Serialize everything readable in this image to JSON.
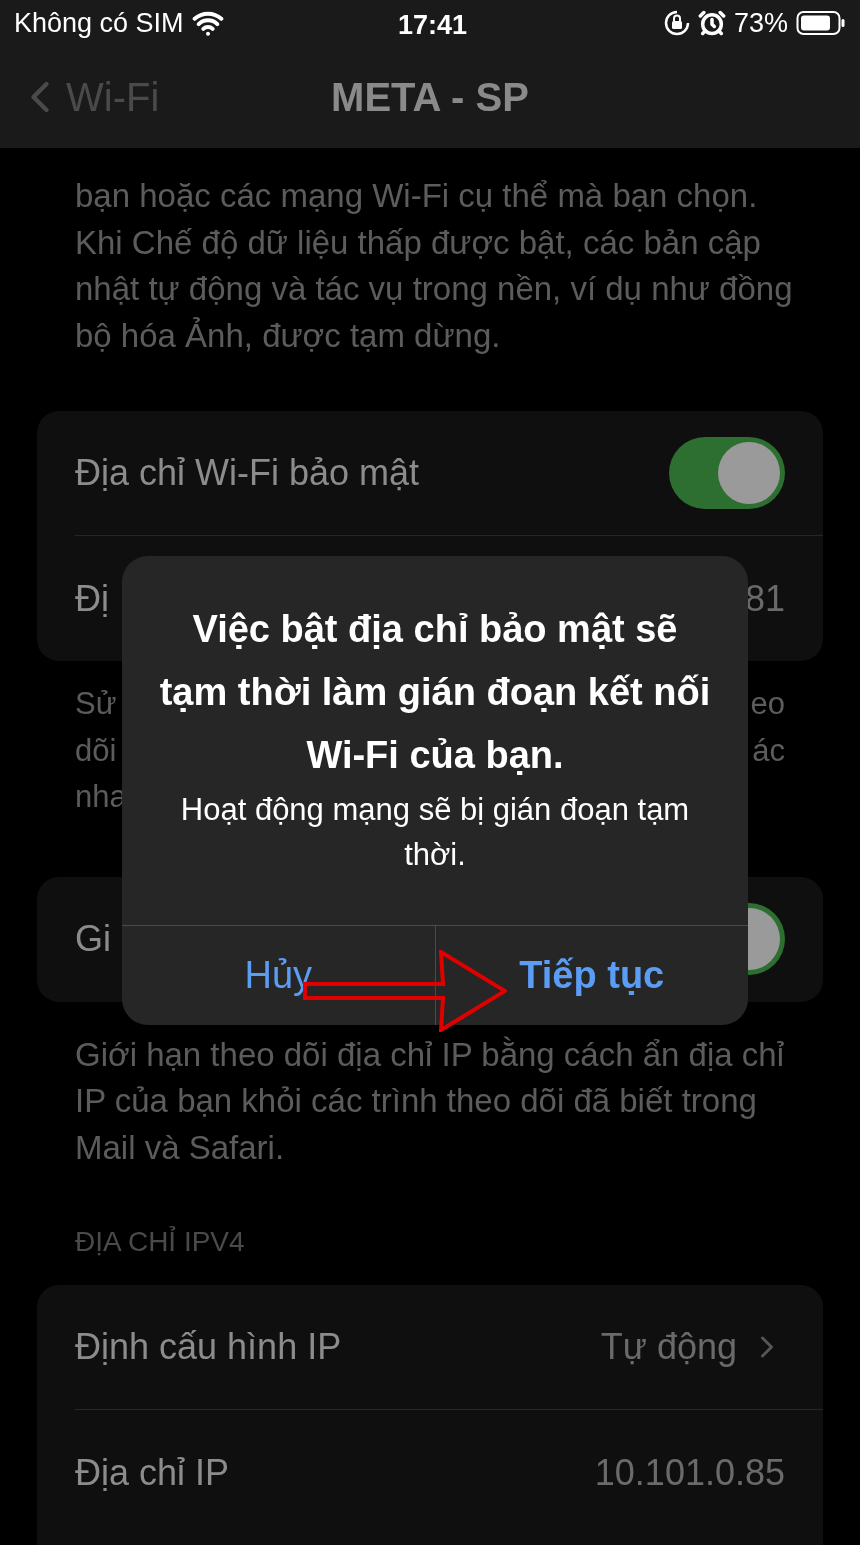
{
  "status_bar": {
    "carrier": "Không có SIM",
    "time": "17:41",
    "battery": "73%"
  },
  "nav": {
    "back": "Wi-Fi",
    "title": "META - SP"
  },
  "low_data_note": "bạn hoặc các mạng Wi-Fi cụ thể mà bạn chọn. Khi Chế độ dữ liệu thấp được bật, các bản cập nhật tự động và tác vụ trong nền, ví dụ như đồng bộ hóa Ảnh, được tạm dừng.",
  "private_address": {
    "rows": [
      {
        "kind": "toggle",
        "label": "Địa chỉ Wi-Fi bảo mật",
        "on": true
      },
      {
        "kind": "value",
        "label": "Đị",
        "value": "81"
      }
    ],
    "footnote_lines": [
      {
        "left": "Sử",
        "right": "eo"
      },
      {
        "left": "dõi",
        "right": "ác"
      },
      {
        "left": "nha"
      }
    ]
  },
  "limit_tracking": {
    "rows": [
      {
        "kind": "toggle",
        "label": "Gi",
        "on": true
      }
    ],
    "footnote": "Giới hạn theo dõi địa chỉ IP bằng cách ẩn địa chỉ IP của bạn khỏi các trình theo dõi đã biết trong Mail và Safari."
  },
  "ipv4": {
    "header": "ĐỊA CHỈ IPV4",
    "rows": [
      {
        "kind": "link",
        "label": "Định cấu hình IP",
        "value": "Tự động"
      },
      {
        "kind": "value",
        "label": "Địa chỉ IP",
        "value": "10.101.0.85"
      }
    ]
  },
  "alert": {
    "title": "Việc bật địa chỉ bảo mật sẽ tạm thời làm gián đoạn kết nối Wi-Fi của bạn.",
    "message": "Hoạt động mạng sẽ bị gián đoạn tạm thời.",
    "buttons": [
      {
        "label": "Hủy",
        "bold": false
      },
      {
        "label": "Tiếp tục",
        "bold": true
      }
    ]
  }
}
